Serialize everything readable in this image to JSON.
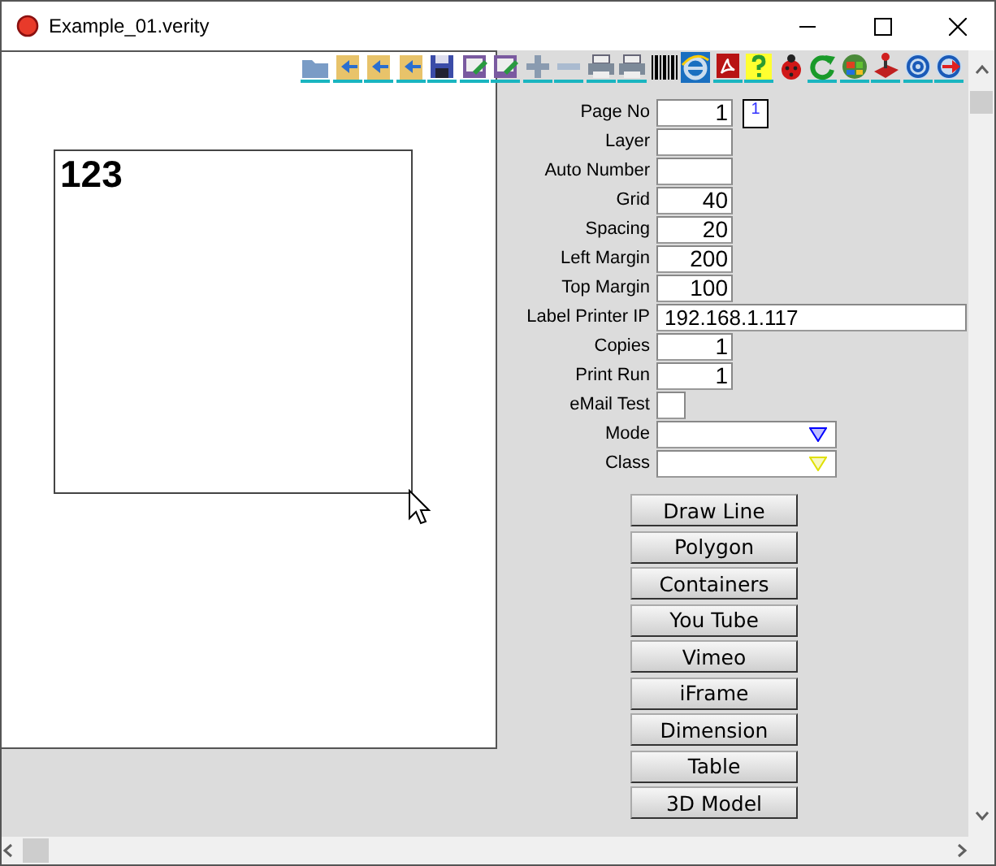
{
  "window": {
    "title": "Example_01.verity"
  },
  "canvas": {
    "label_text": "123"
  },
  "fields": [
    {
      "kind": "number",
      "label": "Page No",
      "value": "1",
      "page_indicator": "1"
    },
    {
      "kind": "number",
      "label": "Layer"
    },
    {
      "kind": "number",
      "label": "Auto Number"
    },
    {
      "kind": "number",
      "label": "Grid",
      "value": "40"
    },
    {
      "kind": "number",
      "label": "Spacing",
      "value": "20"
    },
    {
      "kind": "number",
      "label": "Left Margin",
      "value": "200"
    },
    {
      "kind": "number",
      "label": "Top Margin",
      "value": "100"
    },
    {
      "kind": "wide",
      "label": "Label Printer IP",
      "value": "192.168.1.117"
    },
    {
      "kind": "number",
      "label": "Copies",
      "value": "1"
    },
    {
      "kind": "number",
      "label": "Print Run",
      "value": "1"
    },
    {
      "kind": "check",
      "label": "eMail Test",
      "checked": false
    },
    {
      "kind": "dropdown",
      "label": "Mode",
      "color": "#0000ff"
    },
    {
      "kind": "dropdown",
      "label": "Class",
      "color": "#e0e000"
    }
  ],
  "buttons": [
    "Draw Line",
    "Polygon",
    "Containers",
    "You Tube",
    "Vimeo",
    "iFrame",
    "Dimension",
    "Table",
    "3D Model"
  ]
}
